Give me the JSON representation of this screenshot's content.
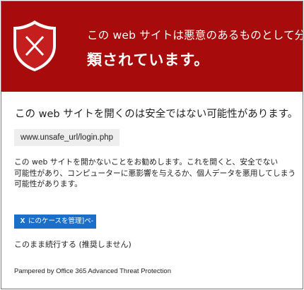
{
  "banner": {
    "shield_icon": "shield-x-icon",
    "line1": "この web サイトは悪意のあるものとして分",
    "line2": "類されています。",
    "background_color": "#a80b0b"
  },
  "content": {
    "headline": "この web サイトを開くのは安全ではない可能性があります。",
    "url": "www.unsafe_url/login.php",
    "body_lines": [
      "この web サイトを開かないことをお勧めします。これを開くと、安全でない",
      "可能性があり、コンピューターに悪影響を与えるか、個人データを悪用してしまう",
      "可能性があります。"
    ]
  },
  "actions": {
    "report_button_icon": "X",
    "report_button_label": "にのケースを管理]ペ-",
    "report_button_color": "#1c6fc9",
    "continue_link": "このまま続行する (推奨しません)"
  },
  "footer": {
    "text": "Pampered by Office 365 Advanced Threat Protection"
  }
}
